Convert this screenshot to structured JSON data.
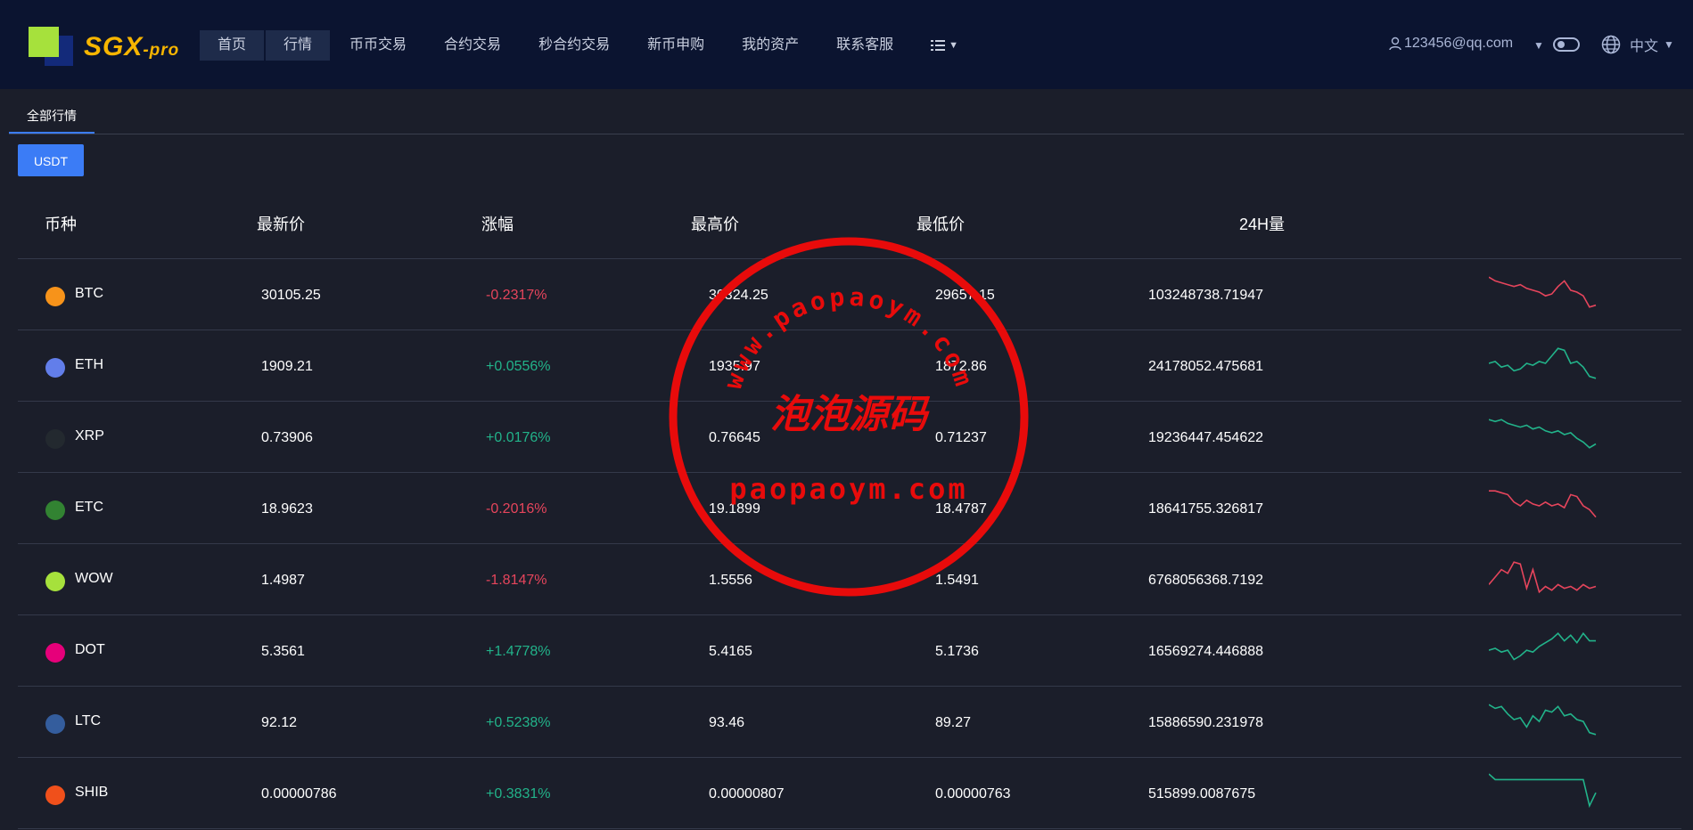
{
  "header": {
    "brand": "SGX",
    "brand_suffix": "-pro",
    "nav": [
      {
        "label": "首页",
        "active": true
      },
      {
        "label": "行情",
        "active": true
      },
      {
        "label": "币币交易",
        "active": false
      },
      {
        "label": "合约交易",
        "active": false
      },
      {
        "label": "秒合约交易",
        "active": false
      },
      {
        "label": "新币申购",
        "active": false
      },
      {
        "label": "我的资产",
        "active": false
      },
      {
        "label": "联系客服",
        "active": false
      }
    ],
    "more_icon": "list-icon",
    "user_email": "123456@qq.com",
    "language": "中文"
  },
  "tabs": [
    {
      "label": "全部行情",
      "active": true
    }
  ],
  "quote_button": "USDT",
  "table": {
    "headers": [
      "币种",
      "最新价",
      "涨幅",
      "最高价",
      "最低价",
      "24H量"
    ],
    "rows": [
      {
        "symbol": "BTC",
        "price": "30105.25",
        "change": "-0.2317%",
        "dir": "down",
        "high": "30324.25",
        "low": "29657.15",
        "volume": "103248738.71947",
        "icon_color": "#f7931a",
        "spark": [
          0.1,
          0.2,
          0.25,
          0.3,
          0.35,
          0.3,
          0.4,
          0.45,
          0.5,
          0.6,
          0.55,
          0.35,
          0.2,
          0.45,
          0.5,
          0.6,
          0.9,
          0.85
        ]
      },
      {
        "symbol": "ETH",
        "price": "1909.21",
        "change": "+0.0556%",
        "dir": "up",
        "high": "1935.97",
        "low": "1872.86",
        "volume": "24178052.475681",
        "icon_color": "#627eea",
        "spark": [
          0.5,
          0.45,
          0.6,
          0.55,
          0.7,
          0.65,
          0.5,
          0.55,
          0.45,
          0.5,
          0.3,
          0.1,
          0.15,
          0.5,
          0.45,
          0.6,
          0.85,
          0.9
        ]
      },
      {
        "symbol": "XRP",
        "price": "0.73906",
        "change": "+0.0176%",
        "dir": "up",
        "high": "0.76645",
        "low": "0.71237",
        "volume": "19236447.454622",
        "icon_color": "#23292f",
        "spark": [
          0.1,
          0.15,
          0.1,
          0.2,
          0.25,
          0.3,
          0.25,
          0.35,
          0.3,
          0.4,
          0.45,
          0.4,
          0.5,
          0.45,
          0.6,
          0.7,
          0.85,
          0.75
        ]
      },
      {
        "symbol": "ETC",
        "price": "18.9623",
        "change": "-0.2016%",
        "dir": "down",
        "high": "19.1899",
        "low": "18.4787",
        "volume": "18641755.326817",
        "icon_color": "#328332",
        "spark": [
          0.1,
          0.1,
          0.15,
          0.2,
          0.4,
          0.5,
          0.35,
          0.45,
          0.5,
          0.4,
          0.5,
          0.45,
          0.55,
          0.2,
          0.25,
          0.5,
          0.6,
          0.8
        ]
      },
      {
        "symbol": "WOW",
        "price": "1.4987",
        "change": "-1.8147%",
        "dir": "down",
        "high": "1.5556",
        "low": "1.5491",
        "volume": "6768056368.7192",
        "icon_color": "#a6e13c",
        "spark": [
          0.7,
          0.5,
          0.3,
          0.4,
          0.1,
          0.15,
          0.8,
          0.3,
          0.9,
          0.75,
          0.85,
          0.7,
          0.8,
          0.75,
          0.85,
          0.7,
          0.8,
          0.75
        ]
      },
      {
        "symbol": "DOT",
        "price": "5.3561",
        "change": "+1.4778%",
        "dir": "up",
        "high": "5.4165",
        "low": "5.1736",
        "volume": "16569274.446888",
        "icon_color": "#e6007a",
        "spark": [
          0.55,
          0.5,
          0.6,
          0.55,
          0.8,
          0.7,
          0.55,
          0.6,
          0.45,
          0.35,
          0.25,
          0.1,
          0.3,
          0.15,
          0.35,
          0.1,
          0.3,
          0.3
        ]
      },
      {
        "symbol": "LTC",
        "price": "92.12",
        "change": "+0.5238%",
        "dir": "up",
        "high": "93.46",
        "low": "89.27",
        "volume": "15886590.231978",
        "icon_color": "#345d9d",
        "spark": [
          0.1,
          0.2,
          0.15,
          0.35,
          0.5,
          0.45,
          0.7,
          0.4,
          0.55,
          0.25,
          0.3,
          0.15,
          0.4,
          0.35,
          0.5,
          0.55,
          0.85,
          0.9
        ]
      },
      {
        "symbol": "SHIB",
        "price": "0.00000786",
        "change": "+0.3831%",
        "dir": "up",
        "high": "0.00000807",
        "low": "0.00000763",
        "volume": "515899.0087675",
        "icon_color": "#f0501b",
        "spark": [
          0.05,
          0.2,
          0.2,
          0.2,
          0.2,
          0.2,
          0.2,
          0.2,
          0.2,
          0.2,
          0.2,
          0.2,
          0.2,
          0.2,
          0.2,
          0.2,
          0.9,
          0.55
        ]
      }
    ],
    "colors": {
      "up": "#22b38a",
      "down": "#e6455c"
    }
  },
  "watermark": {
    "top_text": "www.paopaoym.com",
    "center_text": "泡泡源码",
    "bottom_text": "paopaoym.com",
    "color": "#e80b0b"
  }
}
